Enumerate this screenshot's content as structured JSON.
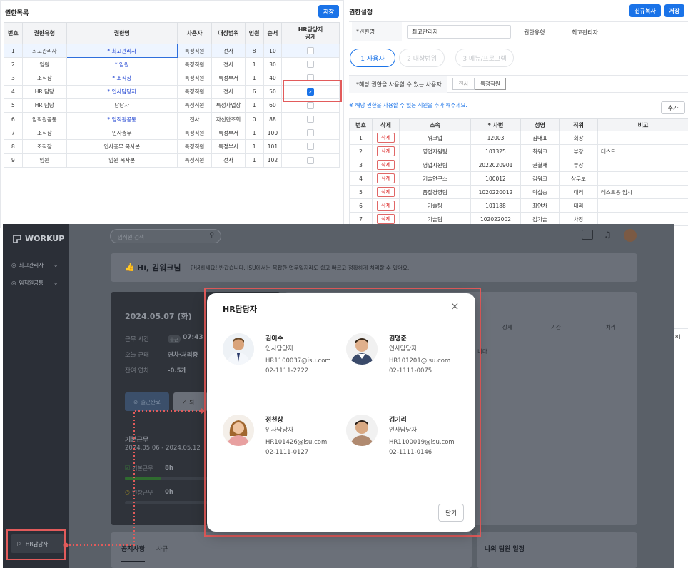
{
  "left": {
    "title": "권한목록",
    "save_label": "저장",
    "columns": [
      "번호",
      "권한유형",
      "권한명",
      "사용자",
      "대상범위",
      "인원",
      "순서",
      "HR담당자\n공개"
    ],
    "rows": [
      {
        "no": "1",
        "type": "최고관리자",
        "name": "* 최고관리자",
        "user": "특정직원",
        "scope": "전사",
        "count": "8",
        "order": "10",
        "hr": false,
        "link": true
      },
      {
        "no": "2",
        "type": "임원",
        "name": "* 임원",
        "user": "특정직원",
        "scope": "전사",
        "count": "1",
        "order": "30",
        "hr": false,
        "link": true
      },
      {
        "no": "3",
        "type": "조직장",
        "name": "* 조직장",
        "user": "특정직원",
        "scope": "특정부서",
        "count": "1",
        "order": "40",
        "hr": false,
        "link": true
      },
      {
        "no": "4",
        "type": "HR 담당",
        "name": "* 인사담당자",
        "user": "특정직원",
        "scope": "전사",
        "count": "6",
        "order": "50",
        "hr": true,
        "link": true
      },
      {
        "no": "5",
        "type": "HR 담당",
        "name": "담당자",
        "user": "특정직원",
        "scope": "특정사업장",
        "count": "1",
        "order": "60",
        "hr": false,
        "link": false
      },
      {
        "no": "6",
        "type": "임직원공통",
        "name": "* 임직원공통",
        "user": "전사",
        "scope": "자신만조회",
        "count": "0",
        "order": "88",
        "hr": false,
        "link": true
      },
      {
        "no": "7",
        "type": "조직장",
        "name": "인사총무",
        "user": "특정직원",
        "scope": "특정부서",
        "count": "1",
        "order": "100",
        "hr": false,
        "link": false
      },
      {
        "no": "8",
        "type": "조직장",
        "name": "인사총무 복사본",
        "user": "특정직원",
        "scope": "특정부서",
        "count": "1",
        "order": "101",
        "hr": false,
        "link": false
      },
      {
        "no": "9",
        "type": "임원",
        "name": "임원 복사본",
        "user": "특정직원",
        "scope": "전사",
        "count": "1",
        "order": "102",
        "hr": false,
        "link": false
      }
    ]
  },
  "right": {
    "title": "권한설정",
    "new_copy_label": "신규복사",
    "save_label": "저장",
    "name_label": "*권한명",
    "name_value": "최고관리자",
    "type_label": "권한유형",
    "type_value": "최고관리자",
    "steps": [
      "1  사용자",
      "2  대상범위",
      "3  메뉴/프로그램"
    ],
    "users_label": "*해당 권한을 사용할 수 있는 사용자",
    "toggle_all": "전사",
    "toggle_specific": "특정직원",
    "hint": "※ 해당 권한을 사용할 수 있는 직원을 추가 해주세요.",
    "add_label": "추가",
    "columns": [
      "번호",
      "삭제",
      "소속",
      "* 사번",
      "성명",
      "직위",
      "비고"
    ],
    "delete_label": "삭제",
    "rows": [
      {
        "no": "1",
        "dept": "워크업",
        "emp": "12003",
        "name": "김대표",
        "pos": "회장",
        "note": ""
      },
      {
        "no": "2",
        "dept": "영업지원팀",
        "emp": "101325",
        "name": "최워크",
        "pos": "부장",
        "note": "테스트"
      },
      {
        "no": "3",
        "dept": "영업지원팀",
        "emp": "2022020901",
        "name": "권결재",
        "pos": "부장",
        "note": ""
      },
      {
        "no": "4",
        "dept": "기술연구소",
        "emp": "100012",
        "name": "김워크",
        "pos": "상무보",
        "note": ""
      },
      {
        "no": "5",
        "dept": "품질경영팀",
        "emp": "1020220012",
        "name": "락섭승",
        "pos": "대리",
        "note": "테스트용 임시"
      },
      {
        "no": "6",
        "dept": "기술팀",
        "emp": "101188",
        "name": "최연차",
        "pos": "대리",
        "note": ""
      },
      {
        "no": "7",
        "dept": "기술팀",
        "emp": "102022002",
        "name": "김기술",
        "pos": "차장",
        "note": ""
      }
    ],
    "side_header_detail": "상세",
    "side_header_period": "기간",
    "side_header_process": "처리",
    "side_msg": "니다.",
    "side_page": "8]"
  },
  "app": {
    "logo": "WORKUP",
    "search_placeholder": "임직원 검색",
    "sidebar": [
      {
        "label": "최고관리자"
      },
      {
        "label": "임직원공통"
      }
    ],
    "hr_button": "HR담당자",
    "greeting": "Hi, 김워크님",
    "greeting_sub": "안녕하세요! 반갑습니다. ISU에서는 복잡한 업무일지라도 쉽고 빠르고 정확하게 처리할 수 있어요.",
    "date": "2024.05.07 (화)",
    "work_time_label": "근무 시간",
    "work_time_tag": "출근",
    "work_time": "07:43",
    "today_label": "오늘 근태",
    "today_value": "연차·처리중",
    "leave_label": "잔여 연차",
    "leave_value": "-0.5개",
    "checkin_label": "출근완료",
    "checkout_label": "퇴",
    "basic_title": "기본근무",
    "basic_period": "2024.05.06 - 2024.05.12",
    "basic_label": "기본근무",
    "basic_value": "8h",
    "ext_label": "연장근무",
    "ext_value": "0h",
    "notice_tab": "공지사항",
    "notice_tab2": "사규",
    "team_title": "나의 팀원 일정"
  },
  "modal": {
    "title": "HR담당자",
    "close_label": "닫기",
    "people": [
      {
        "name": "김이수",
        "role": "인사담당자",
        "email": "HR1100037@isu.com",
        "tel": "02-1111-2222"
      },
      {
        "name": "김명준",
        "role": "인사담당자",
        "email": "HR101201@isu.com",
        "tel": "02-1111-0075"
      },
      {
        "name": "정천상",
        "role": "인사담당자",
        "email": "HR101426@isu.com",
        "tel": "02-1111-0127"
      },
      {
        "name": "김기리",
        "role": "인사담당자",
        "email": "HR1100019@isu.com",
        "tel": "02-1111-0146"
      }
    ]
  },
  "colors": {
    "accent": "#1a73e8",
    "highlight": "#e25b5b",
    "sidebar": "#2b2f37"
  }
}
